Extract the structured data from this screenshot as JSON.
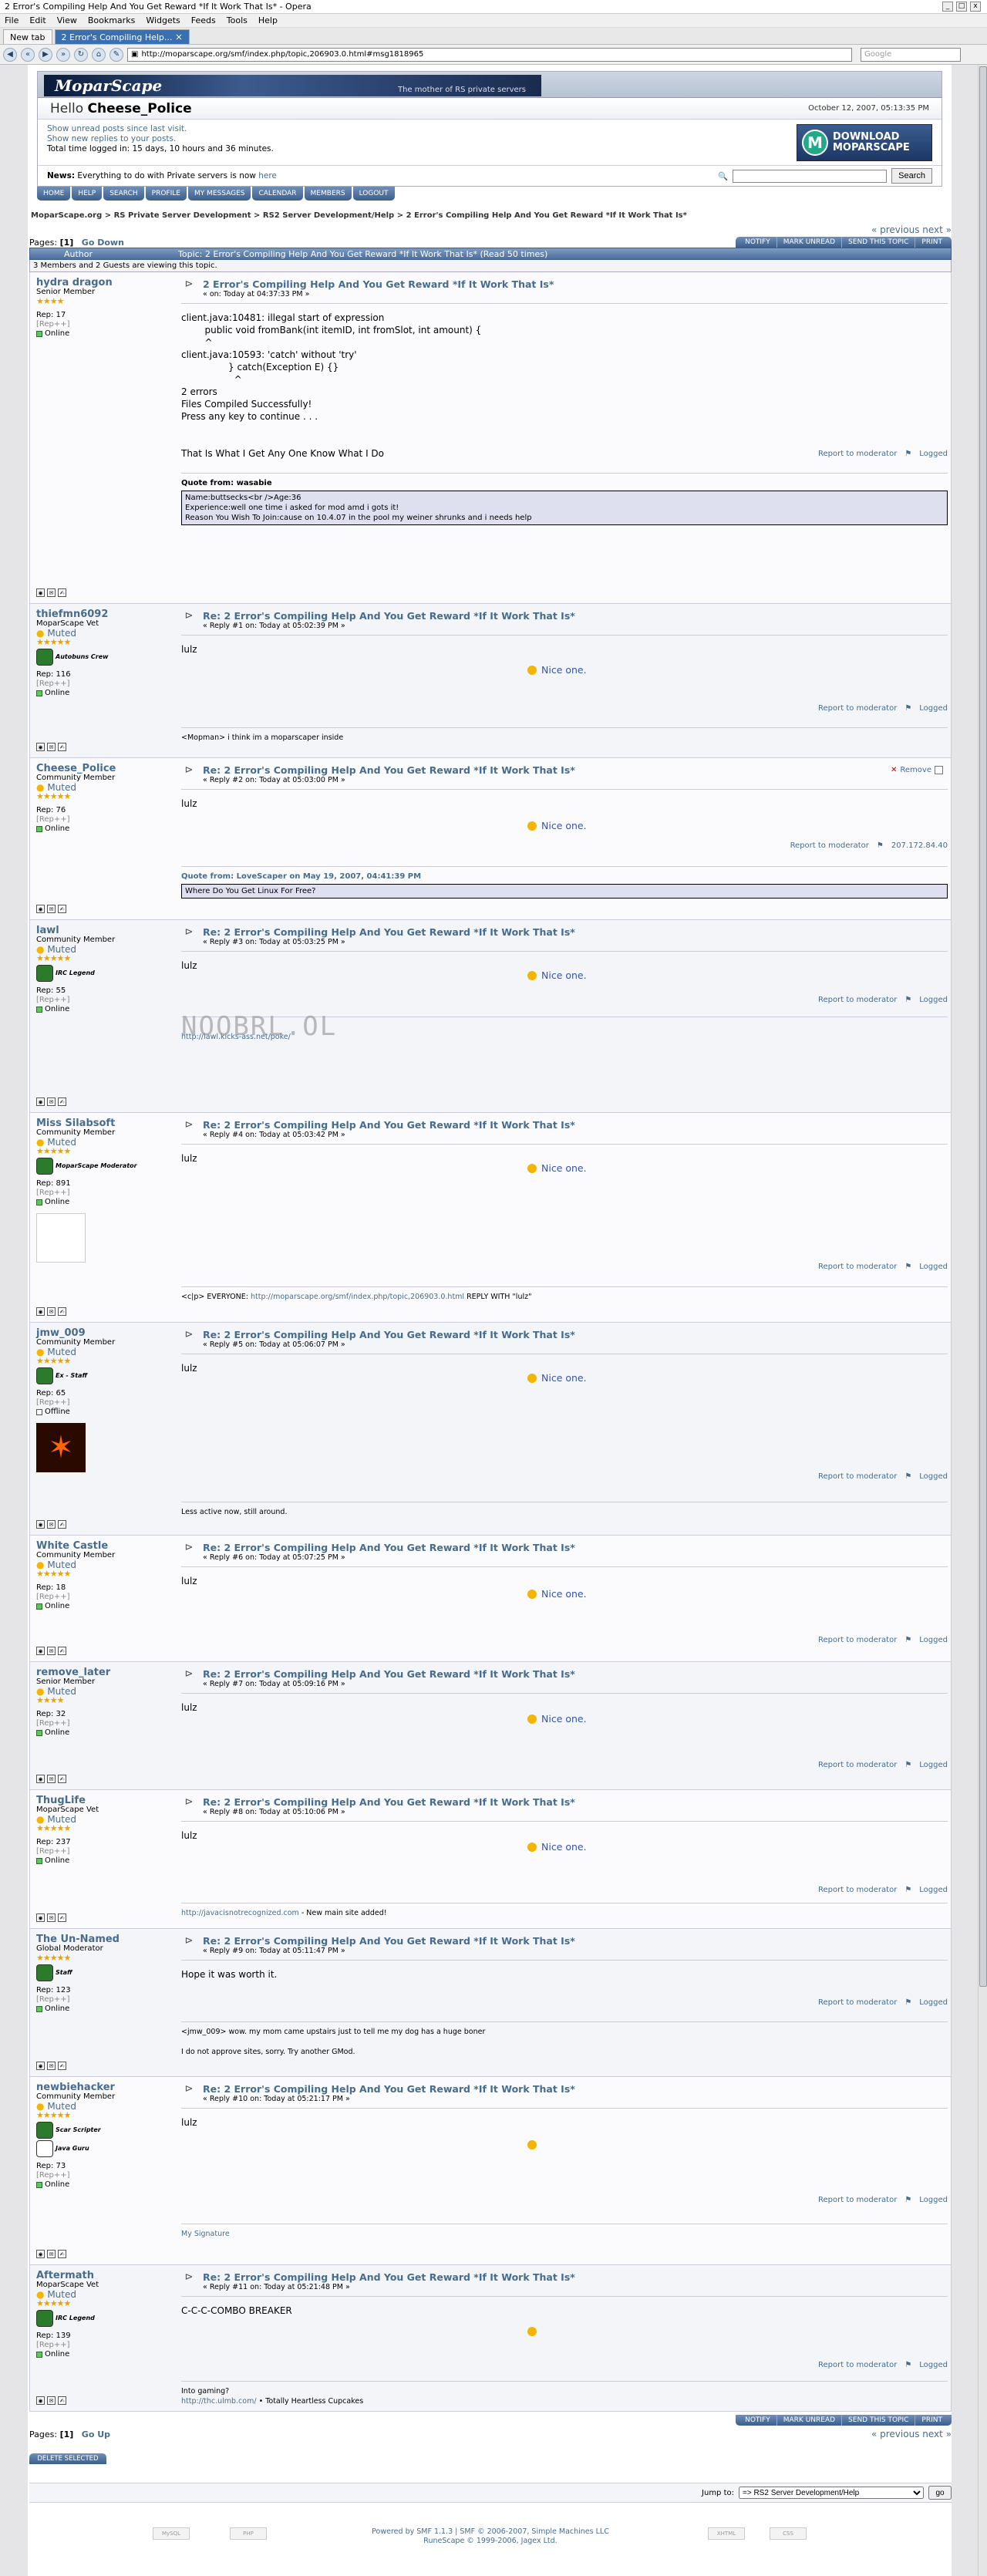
{
  "window": {
    "title": "2 Error's Compiling Help And You Get Reward *If It Work That Is* - Opera",
    "controls": [
      "_",
      "□",
      "x"
    ]
  },
  "menu": [
    "File",
    "Edit",
    "View",
    "Bookmarks",
    "Widgets",
    "Feeds",
    "Tools",
    "Help"
  ],
  "tabs": [
    {
      "label": "New tab"
    },
    {
      "label": "2 Error's Compiling Help..."
    }
  ],
  "address": {
    "url": "http://moparscape.org/smf/index.php/topic,206903.0.html#msg1818965",
    "search_placeholder": "Google"
  },
  "forum": {
    "logo": "MoparScape",
    "logo_tag": "The mother of RS private servers",
    "hello_prefix": "Hello ",
    "username": "Cheese_Police",
    "date": "October 12, 2007, 05:13:35 PM",
    "links": [
      "Show unread posts since last visit.",
      "Show new replies to your posts."
    ],
    "total_time": "Total time logged in: 15 days, 10 hours and 36 minutes.",
    "download_button": [
      "DOWNLOAD",
      "MOPARSCAPE"
    ],
    "news_label": "News:",
    "news_text": " Everything to do with Private servers is now ",
    "news_link": "here",
    "search_button": "Search",
    "main_menu": [
      "HOME",
      "HELP",
      "SEARCH",
      "PROFILE",
      "MY MESSAGES",
      "CALENDAR",
      "MEMBERS",
      "LOGOUT"
    ],
    "breadcrumb": [
      "MoparScape.org",
      "RS Private Server Development",
      "RS2 Server Development/Help",
      "2 Error's Compiling Help And You Get Reward *If It Work That Is*"
    ],
    "prev_next": "« previous next »",
    "pages_label": "Pages: ",
    "pages_current": "[1]",
    "go_down": "Go Down",
    "go_up": "Go Up",
    "topic_buttons": [
      "NOTIFY",
      "MARK UNREAD",
      "SEND THIS TOPIC",
      "PRINT"
    ],
    "author_col": "Author",
    "topic_header": "Topic: 2 Error's Compiling Help And You Get Reward *If It Work That Is*  (Read 50 times)",
    "viewers": "3 Members and 2 Guests are viewing this topic.",
    "report": "Report to moderator",
    "logged": "Logged",
    "nice": "Nice one.",
    "delete_selected": "DELETE SELECTED",
    "jump_label": "Jump to:",
    "jump_value": "=> RS2 Server Development/Help",
    "jump_go": "go",
    "footer1": "Powered by SMF 1.1.3 | SMF © 2006-2007, Simple Machines LLC",
    "footer2": "RuneScape © 1999-2006, Jagex Ltd."
  },
  "posts": [
    {
      "name": "hydra dragon",
      "title": "Senior Member",
      "stars": "★★★★",
      "badge": "",
      "muted": "",
      "rep": "Rep: 17",
      "repp": "[Rep++]",
      "status": "Online",
      "subject": "2 Error's Compiling Help And You Get Reward *If It Work That Is*",
      "meta": "« on: Today at 04:37:33 PM »",
      "body": "client.java:10481: illegal start of expression\n        public void fromBank(int itemID, int fromSlot, int amount) {\n        ^\nclient.java:10593: 'catch' without 'try'\n                } catch(Exception E) {}\n                  ^\n2 errors\nFiles Compiled Successfully!\nPress any key to continue . . .\n\n\nThat Is What I Get Any One Know What I Do",
      "quote_head": "Quote from: wasabie",
      "quote": "Name:buttsecks<br />Age:36\nExperience:well one time i asked for mod amd i gots it!\nReason You Wish To Join:cause on 10.4.07 in the pool my weiner shrunks and i needs help"
    },
    {
      "name": "thiefmn6092",
      "title": "MoparScape Vet",
      "stars": "★★★★★",
      "badge": "Autobuns Crew",
      "muted": "Muted",
      "rep": "Rep: 116",
      "repp": "[Rep++]",
      "status": "Online",
      "subject": "Re: 2 Error's Compiling Help And You Get Reward *If It Work That Is*",
      "meta": "« Reply #1 on: Today at 05:02:39 PM »",
      "body": "lulz",
      "sig": "<Mopman> i think im a moparscaper inside"
    },
    {
      "name": "Cheese_Police",
      "title": "Community Member",
      "stars": "★★★★★",
      "badge": "",
      "muted": "Muted",
      "rep": "Rep: 76",
      "repp": "[Rep++]",
      "status": "Online",
      "subject": "Re: 2 Error's Compiling Help And You Get Reward *If It Work That Is*",
      "meta": "« Reply #2 on: Today at 05:03:00 PM »",
      "body": "lulz",
      "remove": "Remove",
      "ip": "207.172.84.40",
      "quote_head": "Quote from: LoveScaper on May 19, 2007, 04:41:39 PM",
      "quote": "Where Do You Get Linux For Free?"
    },
    {
      "name": "lawl",
      "title": "Community Member",
      "stars": "★★★★★",
      "badge": "IRC Legend",
      "muted": "Muted",
      "rep": "Rep: 55",
      "repp": "[Rep++]",
      "status": "Online",
      "subject": "Re: 2 Error's Compiling Help And You Get Reward *If It Work That Is*",
      "meta": "« Reply #3 on: Today at 05:03:25 PM »",
      "body": "lulz",
      "sigimg": "NOOBRL.OL",
      "sig": "http://lawl.kicks-ass.net/poke/"
    },
    {
      "name": "Miss Silabsoft",
      "title": "Community Member",
      "stars": "★★★★★",
      "badge": "MoparScape Moderator",
      "muted": "Muted",
      "rep": "Rep: 891",
      "repp": "[Rep++]",
      "status": "Online",
      "subject": "Re: 2 Error's Compiling Help And You Get Reward *If It Work That Is*",
      "meta": "« Reply #4 on: Today at 05:03:42 PM »",
      "body": "lulz",
      "sig_pre": "<c|p> EVERYONE: ",
      "sig_link": "http://moparscape.org/smf/index.php/topic,206903.0.html",
      "sig_post": " REPLY WITH \"lulz\""
    },
    {
      "name": "jmw_009",
      "title": "Community Member",
      "stars": "★★★★★",
      "badge": "Ex - Staff",
      "muted": "Muted",
      "rep": "Rep: 65",
      "repp": "[Rep++]",
      "status": "Offline",
      "subject": "Re: 2 Error's Compiling Help And You Get Reward *If It Work That Is*",
      "meta": "« Reply #5 on: Today at 05:06:07 PM »",
      "body": "lulz",
      "sig": "Less active now, still around."
    },
    {
      "name": "White Castle",
      "title": "Community Member",
      "stars": "★★★★★",
      "badge": "",
      "muted": "Muted",
      "rep": "Rep: 18",
      "repp": "[Rep++]",
      "status": "Online",
      "subject": "Re: 2 Error's Compiling Help And You Get Reward *If It Work That Is*",
      "meta": "« Reply #6 on: Today at 05:07:25 PM »",
      "body": "lulz"
    },
    {
      "name": "remove_later",
      "title": "Senior Member",
      "stars": "★★★★",
      "badge": "",
      "muted": "Muted",
      "rep": "Rep: 32",
      "repp": "[Rep++]",
      "status": "Online",
      "subject": "Re: 2 Error's Compiling Help And You Get Reward *If It Work That Is*",
      "meta": "« Reply #7 on: Today at 05:09:16 PM »",
      "body": "lulz"
    },
    {
      "name": "ThugLife",
      "title": "MoparScape Vet",
      "stars": "★★★★★",
      "badge": "",
      "muted": "Muted",
      "rep": "Rep: 237",
      "repp": "[Rep++]",
      "status": "Online",
      "subject": "Re: 2 Error's Compiling Help And You Get Reward *If It Work That Is*",
      "meta": "« Reply #8 on: Today at 05:10:06 PM »",
      "body": "lulz",
      "sig_link": "http://javacisnotrecognized.com",
      "sig_post": " - New main site added!"
    },
    {
      "name": "The Un-Named",
      "title": "Global Moderator",
      "stars": "★★★★★",
      "badge": "Staff",
      "muted": "",
      "rep": "Rep: 123",
      "repp": "[Rep++]",
      "status": "Online",
      "subject": "Re: 2 Error's Compiling Help And You Get Reward *If It Work That Is*",
      "meta": "« Reply #9 on: Today at 05:11:47 PM »",
      "body": "Hope it was worth it.",
      "sig": "<jmw_009> wow. my mom came upstairs just to tell me my dog has a huge boner\n\nI do not approve sites, sorry. Try another GMod."
    },
    {
      "name": "newbiehacker",
      "title": "Community Member",
      "stars": "★★★★★",
      "badge": "Scar Scripter",
      "badge2": "Java Guru",
      "muted": "Muted",
      "rep": "Rep: 73",
      "repp": "[Rep++]",
      "status": "Online",
      "subject": "Re: 2 Error's Compiling Help And You Get Reward *If It Work That Is*",
      "meta": "« Reply #10 on: Today at 05:21:17 PM »",
      "body": "lulz",
      "sig_link": "My Signature"
    },
    {
      "name": "Aftermath",
      "title": "MoparScape Vet",
      "stars": "★★★★★",
      "badge": "IRC Legend",
      "muted": "Muted",
      "rep": "Rep: 139",
      "repp": "[Rep++]",
      "status": "Online",
      "subject": "Re: 2 Error's Compiling Help And You Get Reward *If It Work That Is*",
      "meta": "« Reply #11 on: Today at 05:21:48 PM »",
      "body": "C-C-C-COMBO BREAKER",
      "sig_pre": "Into gaming?\n",
      "sig_link": "http://thc.ulmb.com/",
      "sig_post": " • Totally Heartless Cupcakes"
    }
  ]
}
